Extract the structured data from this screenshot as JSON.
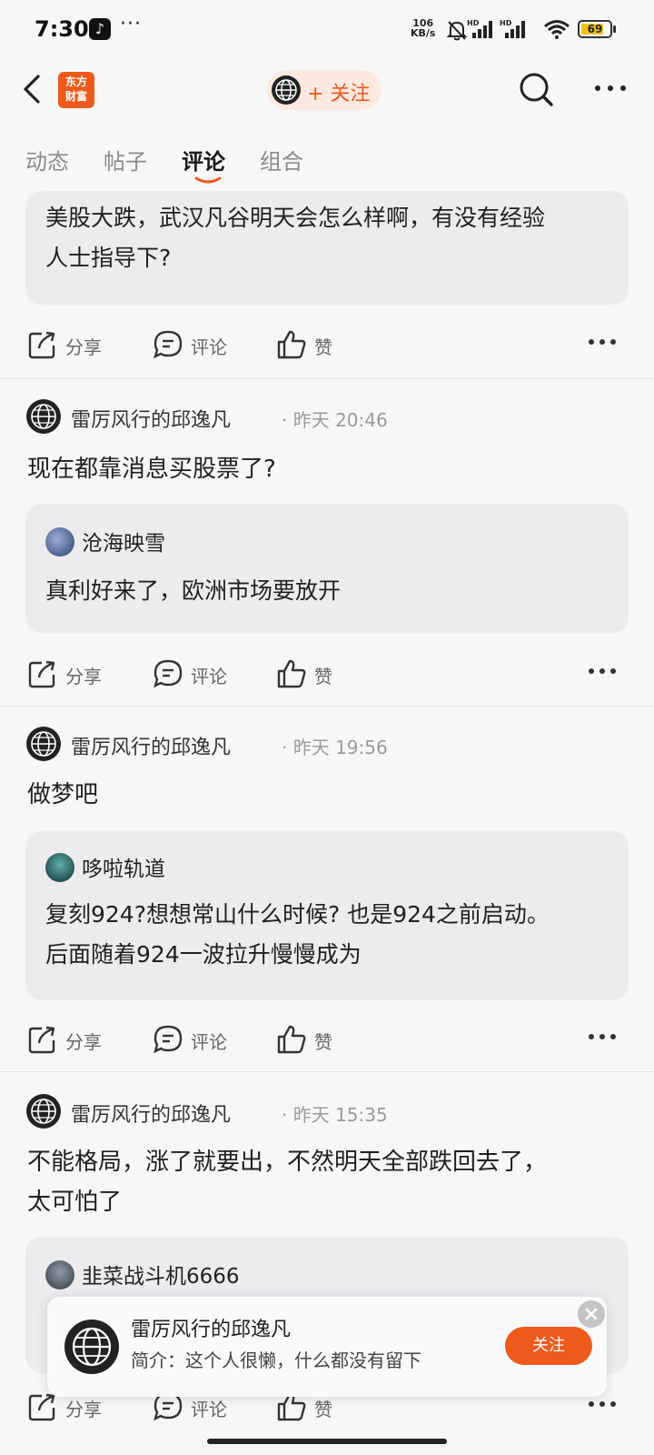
{
  "status": {
    "time": "7:30",
    "net_speed": "106",
    "net_unit": "KB/s",
    "battery": "69"
  },
  "header": {
    "logo_text": "东方\n财富",
    "follow_label": "+ 关注"
  },
  "tabs": [
    {
      "label": "动态"
    },
    {
      "label": "帖子"
    },
    {
      "label": "评论"
    },
    {
      "label": "组合"
    }
  ],
  "actions": {
    "share": "分享",
    "comment": "评论",
    "like": "赞"
  },
  "top_card": {
    "line1": "美股大跌，武汉凡谷明天会怎么样啊，有没有经验",
    "line2": "人士指导下?"
  },
  "posts": [
    {
      "author": "雷厉风行的邱逸凡",
      "meta": "· 昨天 20:46",
      "text": "现在都靠消息买股票了?",
      "quote_author": "沧海映雪",
      "quote_line1": "真利好来了，欧洲市场要放开",
      "quote_line2": ""
    },
    {
      "author": "雷厉风行的邱逸凡",
      "meta": "· 昨天 19:56",
      "text": "做梦吧",
      "quote_author": "哆啦轨道",
      "quote_line1": "复刻924?想想常山什么时候? 也是924之前启动。",
      "quote_line2": "后面随着924一波拉升慢慢成为"
    },
    {
      "author": "雷厉风行的邱逸凡",
      "meta": "· 昨天 15:35",
      "text_line1": "不能格局，涨了就要出，不然明天全部跌回去了，",
      "text_line2": "太可怕了",
      "quote_author": "韭菜战斗机6666"
    }
  ],
  "popup": {
    "name": "雷厉风行的邱逸凡",
    "bio": "简介：这个人很懒，什么都没有留下",
    "follow": "关注"
  },
  "colors": {
    "accent": "#ee5a1c",
    "card_bg": "#ececef",
    "page_bg": "#f7f7f7"
  }
}
